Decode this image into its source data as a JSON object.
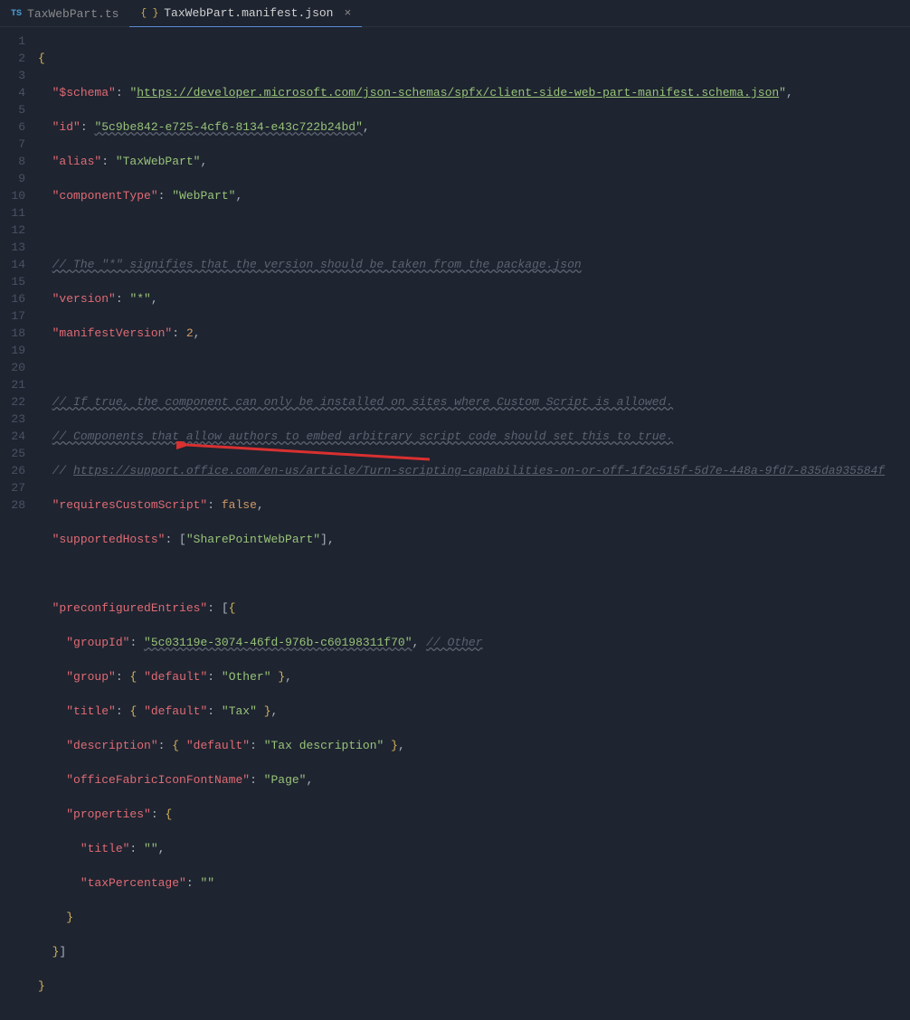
{
  "tabs": {
    "inactive_label": "TaxWebPart.ts",
    "active_label": "TaxWebPart.manifest.json",
    "ts_icon": "TS",
    "json_icon": "{ }",
    "close": "×"
  },
  "lines": {
    "l1": "1",
    "l2": "2",
    "l3": "3",
    "l4": "4",
    "l5": "5",
    "l6": "6",
    "l7": "7",
    "l8": "8",
    "l9": "9",
    "l10": "10",
    "l11": "11",
    "l12": "12",
    "l13": "13",
    "l14": "14",
    "l15": "15",
    "l16": "16",
    "l17": "17",
    "l18": "18",
    "l19": "19",
    "l20": "20",
    "l21": "21",
    "l22": "22",
    "l23": "23",
    "l24": "24",
    "l25": "25",
    "l26": "26",
    "l27": "27",
    "l28": "28"
  },
  "code": {
    "schema_key": "\"$schema\"",
    "schema_val": "https://developer.microsoft.com/json-schemas/spfx/client-side-web-part-manifest.schema.json",
    "id_key": "\"id\"",
    "id_val": "\"5c9be842-e725-4cf6-8134-e43c722b24bd\"",
    "alias_key": "\"alias\"",
    "alias_val": "\"TaxWebPart\"",
    "ctype_key": "\"componentType\"",
    "ctype_val": "\"WebPart\"",
    "c_version": "// The \"*\" signifies that the version should be taken from the package.json",
    "version_key": "\"version\"",
    "version_val": "\"*\"",
    "mver_key": "\"manifestVersion\"",
    "mver_val": "2",
    "c_cs1": "// If true, the component can only be installed on sites where Custom Script is allowed.",
    "c_cs2": "// Components that allow authors to embed arbitrary script code should set this to true.",
    "c_cs3_prefix": "// ",
    "c_cs3_url": "https://support.office.com/en-us/article/Turn-scripting-capabilities-on-or-off-1f2c515f-5d7e-448a-9fd7-835da935584f",
    "rcs_key": "\"requiresCustomScript\"",
    "rcs_val": "false",
    "hosts_key": "\"supportedHosts\"",
    "hosts_val": "\"SharePointWebPart\"",
    "pce_key": "\"preconfiguredEntries\"",
    "gid_key": "\"groupId\"",
    "gid_val": "\"5c03119e-3074-46fd-976b-c60198311f70\"",
    "gid_comment": "// Other",
    "group_key": "\"group\"",
    "default_key": "\"default\"",
    "group_val": "\"Other\"",
    "title_key": "\"title\"",
    "title_val": "\"Tax\"",
    "desc_key": "\"description\"",
    "desc_val": "\"Tax description\"",
    "oficon_key": "\"officeFabricIconFontName\"",
    "oficon_val": "\"Page\"",
    "props_key": "\"properties\"",
    "ptitle_key": "\"title\"",
    "ptitle_val": "\"\"",
    "ptax_key": "\"taxPercentage\"",
    "ptax_val": "\"\""
  }
}
